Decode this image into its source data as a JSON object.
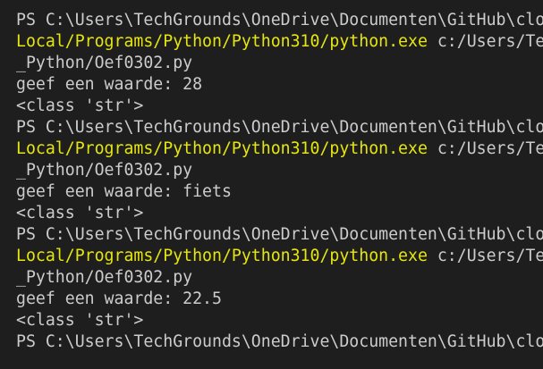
{
  "colors": {
    "background": "#1e1e1e",
    "text": "#cccccc",
    "command_highlight": "#e5e510"
  },
  "terminal": {
    "lines": [
      {
        "parts": [
          {
            "text": "PS C:\\Users\\TechGrounds\\OneDrive\\Documenten\\GitHub\\clo",
            "style": "normal"
          }
        ]
      },
      {
        "parts": [
          {
            "text": "Local/Programs/Python/Python310/python.exe",
            "style": "yellow"
          },
          {
            "text": " c:/Users/Tec",
            "style": "normal"
          }
        ]
      },
      {
        "parts": [
          {
            "text": "_Python/Oef0302.py",
            "style": "normal"
          }
        ]
      },
      {
        "parts": [
          {
            "text": "geef een waarde: 28",
            "style": "normal"
          }
        ]
      },
      {
        "parts": [
          {
            "text": "<class 'str'>",
            "style": "normal"
          }
        ]
      },
      {
        "parts": [
          {
            "text": "PS C:\\Users\\TechGrounds\\OneDrive\\Documenten\\GitHub\\clo",
            "style": "normal"
          }
        ]
      },
      {
        "parts": [
          {
            "text": "Local/Programs/Python/Python310/python.exe",
            "style": "yellow"
          },
          {
            "text": " c:/Users/Tec",
            "style": "normal"
          }
        ]
      },
      {
        "parts": [
          {
            "text": "_Python/Oef0302.py",
            "style": "normal"
          }
        ]
      },
      {
        "parts": [
          {
            "text": "geef een waarde: fiets",
            "style": "normal"
          }
        ]
      },
      {
        "parts": [
          {
            "text": "<class 'str'>",
            "style": "normal"
          }
        ]
      },
      {
        "parts": [
          {
            "text": "PS C:\\Users\\TechGrounds\\OneDrive\\Documenten\\GitHub\\clo",
            "style": "normal"
          }
        ]
      },
      {
        "parts": [
          {
            "text": "Local/Programs/Python/Python310/python.exe",
            "style": "yellow"
          },
          {
            "text": " c:/Users/Tec",
            "style": "normal"
          }
        ]
      },
      {
        "parts": [
          {
            "text": "_Python/Oef0302.py",
            "style": "normal"
          }
        ]
      },
      {
        "parts": [
          {
            "text": "geef een waarde: 22.5",
            "style": "normal"
          }
        ]
      },
      {
        "parts": [
          {
            "text": "<class 'str'>",
            "style": "normal"
          }
        ]
      },
      {
        "parts": [
          {
            "text": "PS C:\\Users\\TechGrounds\\OneDrive\\Documenten\\GitHub\\clo",
            "style": "normal"
          }
        ]
      }
    ]
  }
}
